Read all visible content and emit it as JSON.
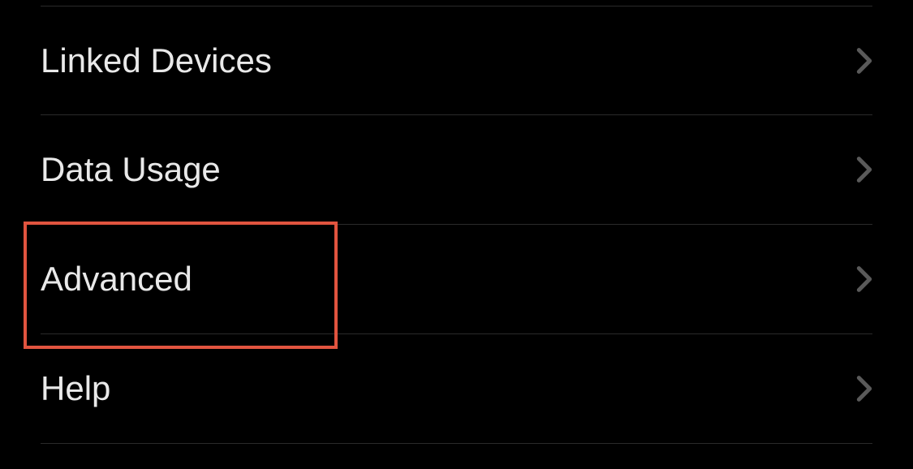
{
  "settings": {
    "items": [
      {
        "label": "Linked Devices"
      },
      {
        "label": "Data Usage"
      },
      {
        "label": "Advanced"
      },
      {
        "label": "Help"
      }
    ]
  }
}
